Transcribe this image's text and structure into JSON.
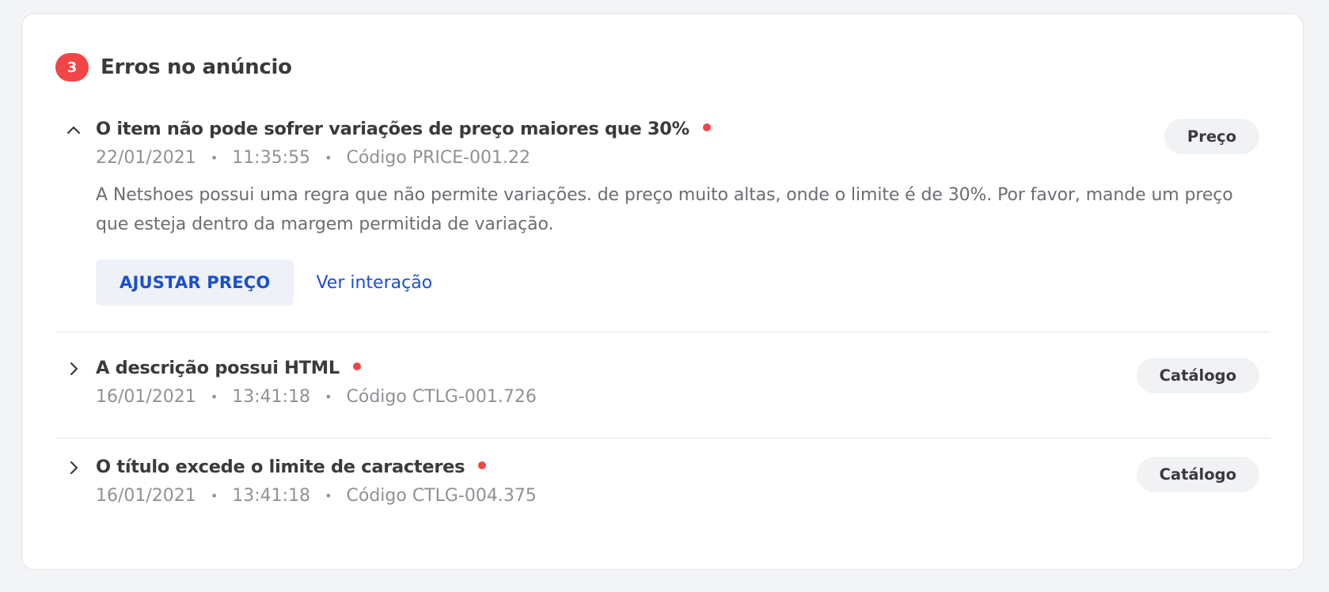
{
  "header": {
    "count": "3",
    "title": "Erros no anúncio"
  },
  "errors": [
    {
      "title": "O item não pode sofrer variações de preço maiores que 30%",
      "date": "22/01/2021",
      "time": "11:35:55",
      "code": "Código PRICE-001.22",
      "category": "Preço",
      "expanded": true,
      "description": "A Netshoes possui uma regra que não permite variações. de preço muito altas, onde o limite é de 30%. Por favor, mande um preço que esteja dentro da margem permitida de variação.",
      "primary_action": "AJUSTAR PREÇO",
      "secondary_action": "Ver interação"
    },
    {
      "title": "A descrição possui HTML",
      "date": "16/01/2021",
      "time": "13:41:18",
      "code": "Código CTLG-001.726",
      "category": "Catálogo",
      "expanded": false
    },
    {
      "title": "O título excede o limite de caracteres",
      "date": "16/01/2021",
      "time": "13:41:18",
      "code": "Código CTLG-004.375",
      "category": "Catálogo",
      "expanded": false
    }
  ],
  "separator": "•",
  "colors": {
    "badge": "#f24545",
    "link": "#1a4fd1",
    "tag_bg": "#f1f2f4"
  },
  "icons": {
    "expanded": "chevron-up-icon",
    "collapsed": "chevron-right-icon"
  }
}
